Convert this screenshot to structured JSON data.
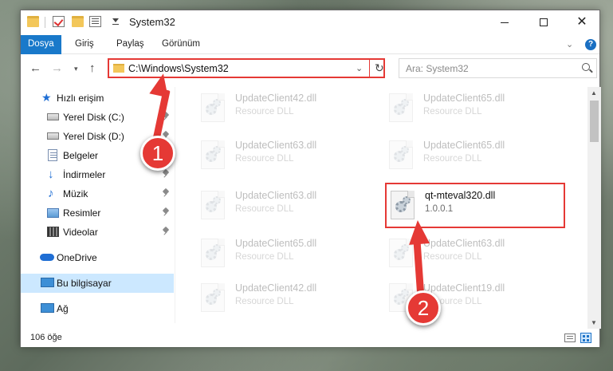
{
  "window": {
    "title": "System32",
    "controls": {
      "minimize": "",
      "maximize": "",
      "close": "✕"
    }
  },
  "ribbon": {
    "tabs": [
      {
        "label": "Dosya",
        "active": true
      },
      {
        "label": "Giriş"
      },
      {
        "label": "Paylaş"
      },
      {
        "label": "Görünüm"
      }
    ],
    "help": "?"
  },
  "navbar": {
    "back": "←",
    "forward": "→",
    "recent": "▾",
    "up": "↑",
    "address": "C:\\Windows\\System32",
    "address_dropdown": "⌄",
    "refresh": "↻",
    "search_placeholder": "Ara: System32"
  },
  "sidebar": {
    "items": [
      {
        "label": "Hızlı erişim",
        "icon": "star-icon"
      },
      {
        "label": "Yerel Disk (C:)",
        "icon": "drive-icon",
        "pinned": true
      },
      {
        "label": "Yerel Disk (D:)",
        "icon": "drive-icon",
        "pinned": true
      },
      {
        "label": "Belgeler",
        "icon": "documents-icon",
        "pinned": true
      },
      {
        "label": "İndirmeler",
        "icon": "downloads-icon",
        "pinned": true
      },
      {
        "label": "Müzik",
        "icon": "music-icon",
        "pinned": true
      },
      {
        "label": "Resimler",
        "icon": "pictures-icon",
        "pinned": true
      },
      {
        "label": "Videolar",
        "icon": "videos-icon",
        "pinned": true
      },
      {
        "label": "OneDrive",
        "icon": "cloud-icon"
      },
      {
        "label": "Bu bilgisayar",
        "icon": "computer-icon",
        "selected": true
      },
      {
        "label": "Ağ",
        "icon": "network-icon"
      }
    ],
    "glyphs": {
      "star": "★",
      "download": "↓",
      "music": "♪"
    }
  },
  "files": [
    {
      "name": "UpdateClient42.dll",
      "type": "Resource DLL"
    },
    {
      "name": "UpdateClient65.dll",
      "type": "Resource DLL"
    },
    {
      "name": "UpdateClient63.dll",
      "type": "Resource DLL"
    },
    {
      "name": "UpdateClient65.dll",
      "type": "Resource DLL"
    },
    {
      "name": "UpdateClient63.dll",
      "type": "Resource DLL"
    },
    {
      "name": "qt-mteval320.dll",
      "type": "1.0.0.1",
      "highlighted": true
    },
    {
      "name": "UpdateClient65.dll",
      "type": "Resource DLL"
    },
    {
      "name": "UpdateClient63.dll",
      "type": "Resource DLL"
    },
    {
      "name": "UpdateClient42.dll",
      "type": "Resource DLL"
    },
    {
      "name": "UpdateClient19.dll",
      "type": "Resource DLL"
    }
  ],
  "scrollbar": {
    "up": "▲",
    "down": "▼"
  },
  "status": {
    "item_count": "106 öğe"
  },
  "annotations": {
    "step1": "1",
    "step2": "2",
    "color": "#e53935"
  },
  "colors": {
    "accent": "#1979ca",
    "selection": "#cce8ff",
    "annotation": "#e53935"
  }
}
